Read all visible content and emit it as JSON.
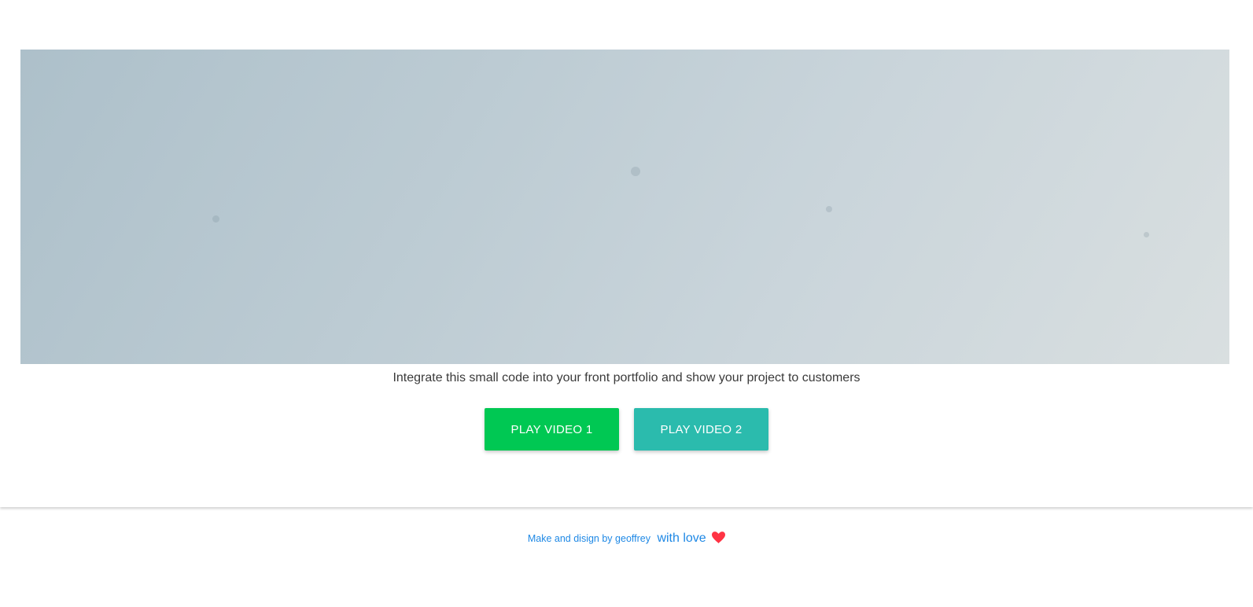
{
  "main": {
    "tagline": "Integrate this small code into your front portfolio and show your project to customers",
    "buttons": [
      {
        "label": "PLAY VIDEO 1",
        "color": "#00c853"
      },
      {
        "label": "PLAY VIDEO 2",
        "color": "#2bbbad"
      }
    ]
  },
  "footer": {
    "credit": "Make and disign by geoffrey",
    "love_text": "with love",
    "heart_icon": "heart-icon",
    "text_color": "#1e88e5",
    "heart_color": "#ff3344"
  }
}
